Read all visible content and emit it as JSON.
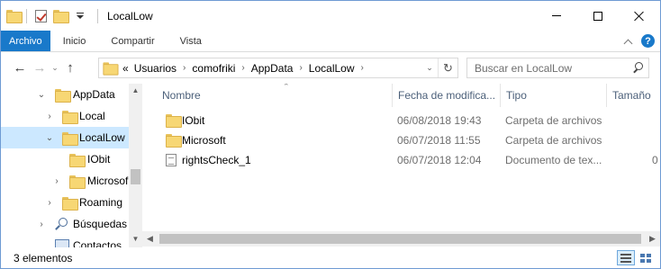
{
  "window": {
    "title": "LocalLow",
    "controls": {
      "minimize": "minimize-icon",
      "maximize": "maximize-icon",
      "close": "close-icon"
    }
  },
  "ribbon": {
    "tabs": [
      "Archivo",
      "Inicio",
      "Compartir",
      "Vista"
    ],
    "help_symbol": "?"
  },
  "nav": {
    "back": "←",
    "forward": "→",
    "recent": "⌄",
    "up": "↑",
    "breadcrumb_overflow": "«",
    "breadcrumbs": [
      "Usuarios",
      "comofriki",
      "AppData",
      "LocalLow"
    ],
    "crumb_separator": "›",
    "refresh": "↻",
    "search_placeholder": "Buscar en LocalLow"
  },
  "tree": {
    "items": [
      {
        "label": "AppData",
        "chevron": "⌄",
        "icon": "folder-icon"
      },
      {
        "label": "Local",
        "chevron": "›",
        "icon": "folder-icon"
      },
      {
        "label": "LocalLow",
        "chevron": "⌄",
        "icon": "folder-icon",
        "selected": true
      },
      {
        "label": "IObit",
        "chevron": "",
        "icon": "folder-icon"
      },
      {
        "label": "Microsof",
        "chevron": "›",
        "icon": "folder-icon"
      },
      {
        "label": "Roaming",
        "chevron": "›",
        "icon": "folder-icon"
      },
      {
        "label": "Búsquedas",
        "chevron": "›",
        "icon": "search-icon"
      },
      {
        "label": "Contactos",
        "chevron": "",
        "icon": "contacts-icon"
      }
    ]
  },
  "columns": {
    "name": "Nombre",
    "date": "Fecha de modifica...",
    "type": "Tipo",
    "size": "Tamaño"
  },
  "files": [
    {
      "name": "IObit",
      "date": "06/08/2018 19:43",
      "type": "Carpeta de archivos",
      "size": "",
      "icon": "folder-icon"
    },
    {
      "name": "Microsoft",
      "date": "06/07/2018 11:55",
      "type": "Carpeta de archivos",
      "size": "",
      "icon": "folder-icon"
    },
    {
      "name": "rightsCheck_1",
      "date": "06/07/2018 12:04",
      "type": "Documento de tex...",
      "size": "0",
      "icon": "text-file-icon"
    }
  ],
  "status": {
    "count_text": "3 elementos"
  },
  "colors": {
    "accent": "#1979ca",
    "selection": "#cce8ff",
    "folder": "#f7d774",
    "border": "#6e9ad3"
  }
}
